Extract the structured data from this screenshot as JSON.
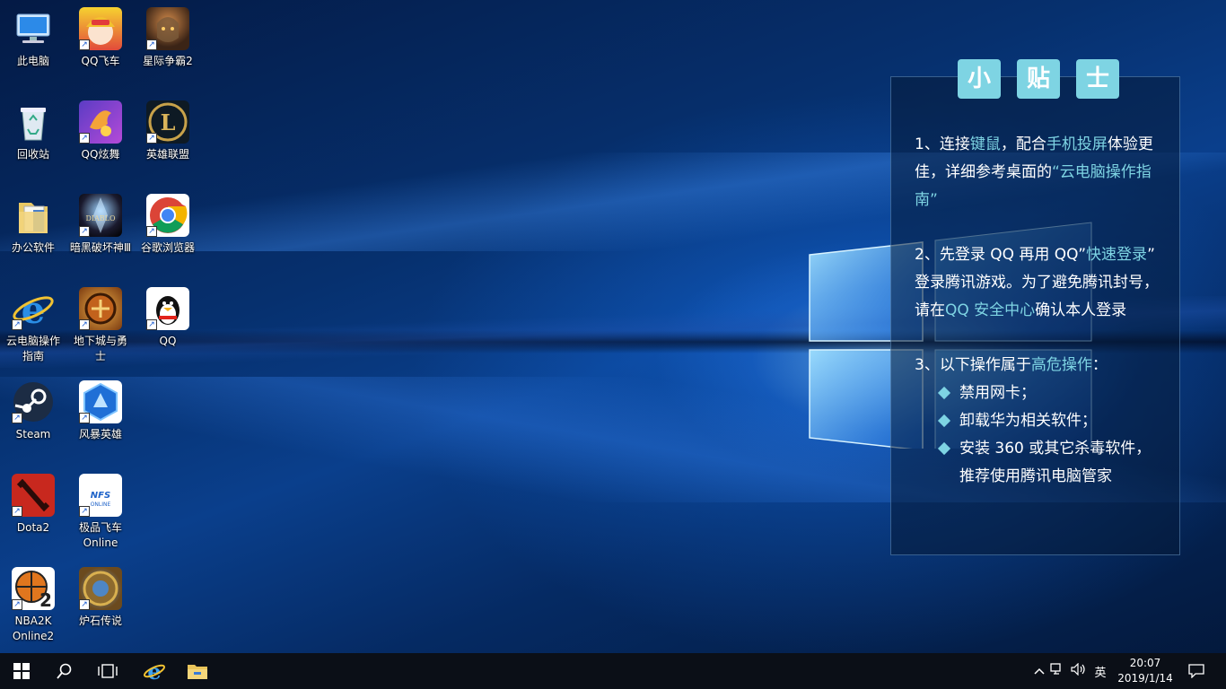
{
  "desktop": {
    "icons": [
      {
        "label": "此电脑"
      },
      {
        "label": "回收站"
      },
      {
        "label": "办公软件"
      },
      {
        "label": "云电脑操作指南"
      },
      {
        "label": "Steam"
      },
      {
        "label": "Dota2"
      },
      {
        "label": "NBA2K Online2"
      },
      {
        "label": "QQ飞车"
      },
      {
        "label": "QQ炫舞"
      },
      {
        "label": "暗黑破坏神Ⅲ"
      },
      {
        "label": "地下城与勇士"
      },
      {
        "label": "风暴英雄"
      },
      {
        "label": "极品飞车Online"
      },
      {
        "label": "炉石传说"
      },
      {
        "label": "星际争霸2"
      },
      {
        "label": "英雄联盟"
      },
      {
        "label": "谷歌浏览器"
      },
      {
        "label": "QQ"
      }
    ]
  },
  "tips": {
    "title_chars": [
      "小",
      "贴",
      "士"
    ],
    "tip1": {
      "a": "1、连接",
      "b": "键鼠",
      "c": "，配合",
      "d": "手机投屏",
      "e": "体验更佳，详细参考桌面的",
      "f": "“云电脑操作指南”"
    },
    "tip2": {
      "a": "2、先登录 QQ 再用 QQ”",
      "b": "快速登录",
      "c": "” 登录腾讯游戏。为了避免腾讯封号，请在",
      "d": "QQ 安全中心",
      "e": "确认本人登录"
    },
    "tip3": {
      "a": "3、以下操作属于",
      "b": "高危操作",
      "c": "：",
      "bullets": [
        "禁用网卡；",
        "卸载华为相关软件；",
        "安装 360 或其它杀毒软件，推荐使用腾讯电脑管家"
      ]
    }
  },
  "taskbar": {
    "ime": "英",
    "time": "20:07",
    "date": "2019/1/14"
  },
  "colors": {
    "accent": "#7ed4e3",
    "taskbar": "#0b0f17"
  }
}
